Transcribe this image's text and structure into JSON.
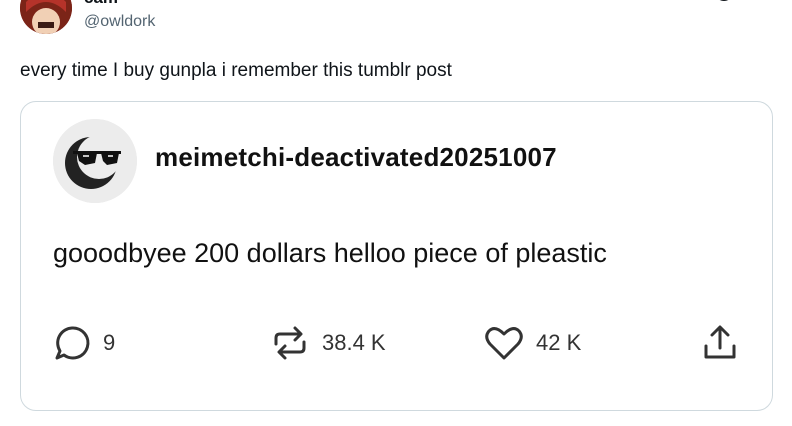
{
  "tweet": {
    "display_name": "cam",
    "handle": "@owldork",
    "text": "every time I buy gunpla i remember this tumblr post"
  },
  "tumblr_post": {
    "blog_name": "meimetchi-deactivated20251007",
    "text": "gooodbyee 200 dollars helloo piece of pleastic",
    "actions": {
      "comments": {
        "icon": "comment-icon",
        "count": "9"
      },
      "reblogs": {
        "icon": "reblog-icon",
        "count": "38.4 K"
      },
      "likes": {
        "icon": "heart-icon",
        "count": "42 K"
      },
      "share": {
        "icon": "share-icon"
      }
    }
  },
  "colors": {
    "text": "#0f1419",
    "secondary": "#536471",
    "border": "#cfd9de"
  }
}
